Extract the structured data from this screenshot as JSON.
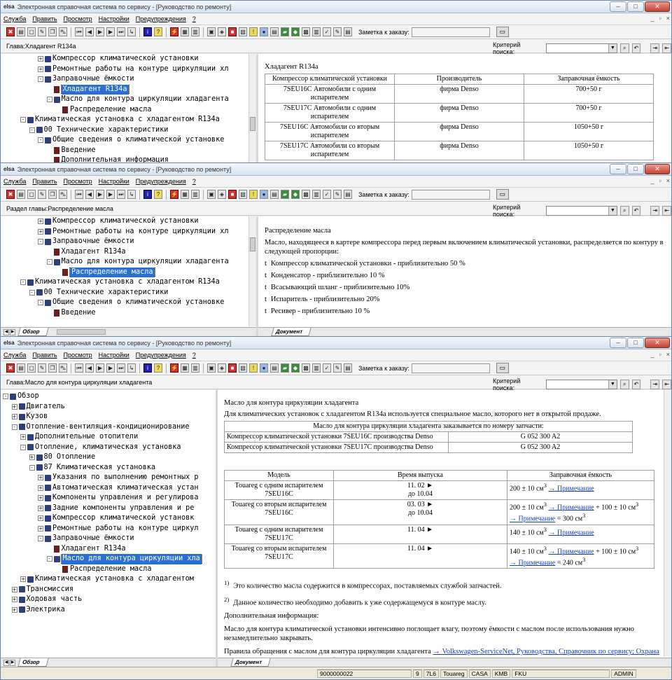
{
  "app": {
    "title": "Электронная справочная система по сервису - [Руководство по ремонту]",
    "logo": "elsa",
    "menu": [
      "Служба",
      "Править",
      "Просмотр",
      "Настройки",
      "Предупреждения",
      "?"
    ],
    "note_label": "Заметка к заказу:",
    "criteria_label": "Критерий поиска:"
  },
  "icons": [
    "exit-icon",
    "print-icon",
    "print-preview-icon",
    "edit-icon",
    "copy-icon",
    "car-icon",
    "first-icon",
    "prev-icon",
    "play-icon",
    "next-icon",
    "last-icon",
    "step-icon",
    "info-icon",
    "help-icon",
    "signal-icon",
    "tool-icon",
    "book-icon",
    "grid-icon",
    "bag-icon",
    "red-book-icon",
    "box-icon",
    "warning-icon",
    "globe-icon",
    "lock-icon",
    "green-book-icon",
    "car-green-icon",
    "network-icon",
    "book2-icon",
    "check-icon",
    "pencil-icon",
    "bookmark-icon"
  ],
  "windows": [
    {
      "chapter": "Глава:Хладагент R134a",
      "tree": [
        {
          "indent": 4,
          "exp": "+",
          "icon": "book",
          "text": "Компрессор климатической установки"
        },
        {
          "indent": 4,
          "exp": "+",
          "icon": "book",
          "text": "Ремонтные работы на контуре циркуляции хл"
        },
        {
          "indent": 4,
          "exp": "-",
          "icon": "book",
          "text": "Заправочные ёмкости"
        },
        {
          "indent": 5,
          "exp": "",
          "icon": "doc",
          "text": "Хладагент R134a",
          "selected": true
        },
        {
          "indent": 5,
          "exp": "-",
          "icon": "book",
          "text": "Масло для контура циркуляции хладагента"
        },
        {
          "indent": 6,
          "exp": "",
          "icon": "doc",
          "text": "Распределение масла"
        },
        {
          "indent": 2,
          "exp": "-",
          "icon": "book",
          "text": "Климатическая установка с хладагентом R134a"
        },
        {
          "indent": 3,
          "exp": "-",
          "icon": "book",
          "text": "00 Технические характеристики"
        },
        {
          "indent": 4,
          "exp": "-",
          "icon": "book",
          "text": "Общие сведения о климатической установке"
        },
        {
          "indent": 5,
          "exp": "",
          "icon": "doc",
          "text": "Введение"
        },
        {
          "indent": 5,
          "exp": "",
          "icon": "doc",
          "text": "Дополнительная информация"
        }
      ],
      "doc_title": "Хладагент R134a",
      "table_headers": [
        "Компрессор климатической установки",
        "Производитель",
        "Заправочная ёмкость"
      ],
      "table_rows": [
        [
          "7SEU16C Автомобили с одним испарителем",
          "фирма Denso",
          "700+50 г"
        ],
        [
          "7SEU17C Автомобили с одним испарителем",
          "фирма Denso",
          "700+50 г"
        ],
        [
          "7SEU16C Автомобили со вторым испарителем",
          "фирма Denso",
          "1050+50 г"
        ],
        [
          "7SEU17C Автомобили со вторым испарителем",
          "фирма Denso",
          "1050+50 г"
        ]
      ]
    },
    {
      "chapter": "Раздел главы:Распределение масла",
      "tree": [
        {
          "indent": 4,
          "exp": "+",
          "icon": "book",
          "text": "Компрессор климатической установки"
        },
        {
          "indent": 4,
          "exp": "+",
          "icon": "book",
          "text": "Ремонтные работы на контуре циркуляции хл"
        },
        {
          "indent": 4,
          "exp": "-",
          "icon": "book",
          "text": "Заправочные ёмкости"
        },
        {
          "indent": 5,
          "exp": "",
          "icon": "doc",
          "text": "Хладагент R134a"
        },
        {
          "indent": 5,
          "exp": "-",
          "icon": "book",
          "text": "Масло для контура циркуляции хладагента"
        },
        {
          "indent": 6,
          "exp": "",
          "icon": "doc",
          "text": "Распределение масла",
          "selected": true
        },
        {
          "indent": 2,
          "exp": "-",
          "icon": "book",
          "text": "Климатическая установка с хладагентом R134a"
        },
        {
          "indent": 3,
          "exp": "-",
          "icon": "book",
          "text": "00 Технические характеристики"
        },
        {
          "indent": 4,
          "exp": "-",
          "icon": "book",
          "text": "Общие сведения о климатической установке"
        },
        {
          "indent": 5,
          "exp": "",
          "icon": "doc",
          "text": "Введение"
        }
      ],
      "tree_tab": "Обзор",
      "doc_tab": "Документ",
      "doc_title": "Распределение масла",
      "intro": "Масло, находящееся в картере компрессора перед первым включением климатической установки, распределяется по контуру в следующей пропорции:",
      "bullets": [
        "Компрессор климатической установки - приблизительно 50 %",
        "Конденсатор - приблизительно 10 %",
        "Всасывающий шланг - приблизительно 10%",
        "Испаритель - приблизительно 20%",
        "Ресивер - приблизительно 10 %"
      ],
      "bullet_mark": "t"
    },
    {
      "chapter": "Глава:Масло для контура циркуляции хладагента",
      "tree": [
        {
          "indent": 0,
          "exp": "-",
          "icon": "book",
          "text": "Обзор"
        },
        {
          "indent": 1,
          "exp": "+",
          "icon": "book",
          "text": "Двигатель"
        },
        {
          "indent": 1,
          "exp": "+",
          "icon": "book",
          "text": "Кузов"
        },
        {
          "indent": 1,
          "exp": "-",
          "icon": "book",
          "text": "Отопление-вентиляция-кондиционирование"
        },
        {
          "indent": 2,
          "exp": "+",
          "icon": "book",
          "text": "Дополнительные отопители"
        },
        {
          "indent": 2,
          "exp": "-",
          "icon": "book",
          "text": "Отопление, климатическая установка"
        },
        {
          "indent": 3,
          "exp": "+",
          "icon": "book",
          "text": "80 Отопление"
        },
        {
          "indent": 3,
          "exp": "-",
          "icon": "book",
          "text": "87 Климатическая установка"
        },
        {
          "indent": 4,
          "exp": "+",
          "icon": "book",
          "text": "Указания по выполнению ремонтных р"
        },
        {
          "indent": 4,
          "exp": "+",
          "icon": "book",
          "text": "Автоматическая климатическая устан"
        },
        {
          "indent": 4,
          "exp": "+",
          "icon": "book",
          "text": "Компоненты управления и регулирова"
        },
        {
          "indent": 4,
          "exp": "+",
          "icon": "book",
          "text": "Задние компоненты управления и ре"
        },
        {
          "indent": 4,
          "exp": "+",
          "icon": "book",
          "text": "Компрессор климатической установк"
        },
        {
          "indent": 4,
          "exp": "+",
          "icon": "book",
          "text": "Ремонтные работы на контуре циркул"
        },
        {
          "indent": 4,
          "exp": "-",
          "icon": "book",
          "text": "Заправочные ёмкости"
        },
        {
          "indent": 5,
          "exp": "",
          "icon": "doc",
          "text": "Хладагент R134a"
        },
        {
          "indent": 5,
          "exp": "-",
          "icon": "book",
          "text": "Масло для контура циркуляции хла",
          "selected": true
        },
        {
          "indent": 6,
          "exp": "",
          "icon": "doc",
          "text": "Распределение масла"
        },
        {
          "indent": 2,
          "exp": "+",
          "icon": "book",
          "text": "Климатическая установка с хладагентом"
        },
        {
          "indent": 1,
          "exp": "+",
          "icon": "book",
          "text": "Трансмиссия"
        },
        {
          "indent": 1,
          "exp": "+",
          "icon": "book",
          "text": "Ходовая часть"
        },
        {
          "indent": 1,
          "exp": "+",
          "icon": "book",
          "text": "Электрика"
        }
      ],
      "tree_tab": "Обзор",
      "doc_tab": "Документ",
      "doc_title": "Масло для контура циркуляции хладагента",
      "intro": "Для климатических установок с хладагентом R134a используется специальное масло, которого нет в открытой продаже.",
      "parts_header": "Масло для контура циркуляции хладагента заказывается по номеру запчасти:",
      "parts": [
        [
          "Компрессор климатической установки 7SEU16C производства Denso",
          "G 052 300 A2"
        ],
        [
          "Компрессор климатической установки 7SEU17C производства Denso",
          "G 052 300 A2"
        ]
      ],
      "models_headers": [
        "Модель",
        "Время выпуска",
        "Заправочная ёмкость"
      ],
      "models": [
        {
          "model": "Touareg с одним испарителем 7SEU16C",
          "from": "11. 02 ►",
          "to": "до 10.04",
          "cap1": "200 ± 10 см",
          "link1": "→ Примечание",
          "cap2": "",
          "link2": "",
          "cap3": ""
        },
        {
          "model": "Touareg со вторым испарителем 7SEU16C",
          "from": "03. 03 ►",
          "to": "до 10.04",
          "cap1": "200 ± 10 см",
          "link1": "→ Примечание",
          "cap2": " + 100 ± 10 см",
          "link2": "→ Примечание",
          "cap3": " = 300 см"
        },
        {
          "model": "Touareg с одним испарителем 7SEU17C",
          "from": "11. 04 ►",
          "to": "",
          "cap1": "140 ± 10 см",
          "link1": "→ Примечание",
          "cap2": "",
          "link2": "",
          "cap3": ""
        },
        {
          "model": "Touareg со вторым испарителем 7SEU17C",
          "from": "11. 04 ►",
          "to": "",
          "cap1": "140 ± 10 см",
          "link1": "→ Примечание",
          "cap2": " + 100 ± 10 см",
          "link2": "→ Примечание",
          "cap3": " = 240 см"
        }
      ],
      "sup3": "3",
      "footnotes": [
        {
          "n": "1)",
          "text": "Это количество масла содержится в компрессорах, поставляемых службой запчастей."
        },
        {
          "n": "2)",
          "text": "Данное количество необходимо добавить к уже содержащемуся в контуре маслу."
        }
      ],
      "add_info_label": "Дополнительная информация:",
      "add_info": "Масло для контура климатической установки интенсивно поглощает влагу, поэтому ёмкости с маслом после использования нужно незамедлительно закрывать.",
      "rules_text": "Правила обращения с маслом для контура циркуляции хладагента ",
      "rules_link": "→ Volkswagen-ServiceNet, Руководства, Справочник по сервису; Охрана окружающей среды; Защита от выбросов",
      "rules_end": "."
    }
  ],
  "statusbar": [
    "9000000022",
    "9",
    "7L6",
    "Touareg",
    "CASA",
    "KMB",
    "FKU",
    "ADMIN"
  ]
}
